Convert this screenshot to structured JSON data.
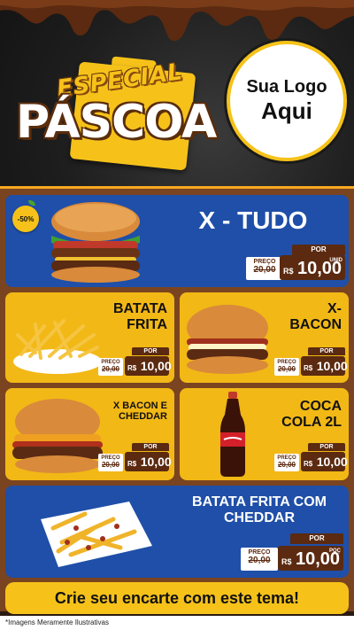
{
  "header": {
    "especial": "ESPECIAL",
    "pascoa": "PÁSCOA",
    "logo_line1": "Sua Logo",
    "logo_line2": "Aqui"
  },
  "colors": {
    "blue_card": "#1f4fa8",
    "yellow_card": "#f2b816",
    "chocolate": "#5b2a10",
    "accent": "#f6c21a"
  },
  "price_labels": {
    "preco": "PREÇO",
    "old": "20,00",
    "por": "POR",
    "currency": "R$",
    "value": "10,00"
  },
  "items": [
    {
      "name": "X - TUDO",
      "unit": "UNID",
      "discount": "-50%"
    },
    {
      "name_l1": "BATATA",
      "name_l2": "FRITA"
    },
    {
      "name_l1": "X-",
      "name_l2": "BACON"
    },
    {
      "name_l1": "X BACON E",
      "name_l2": "CHEDDAR"
    },
    {
      "name_l1": "COCA",
      "name_l2": "COLA 2L"
    },
    {
      "name_l1": "BATATA FRITA COM",
      "name_l2": "CHEDDAR",
      "unit": "POÇ"
    }
  ],
  "cta": "Crie seu encarte com este tema!",
  "footer_note": "*Imagens Meramente Ilustrativas"
}
